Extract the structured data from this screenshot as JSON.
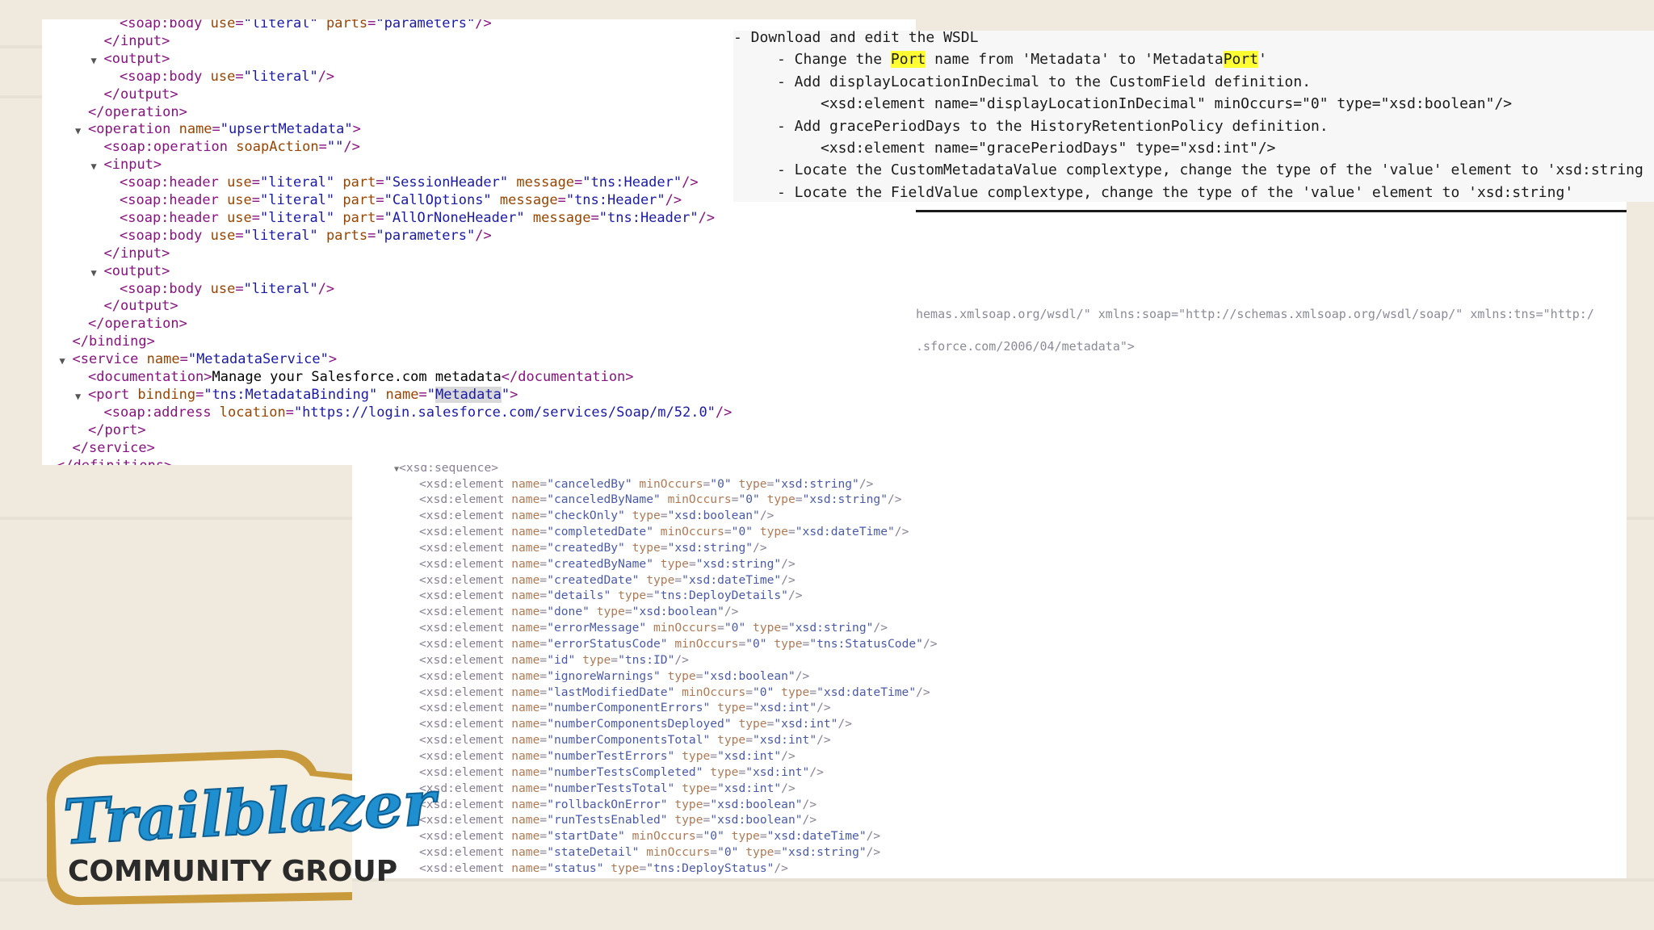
{
  "xml_panel": {
    "lines": [
      {
        "indent": 3,
        "tri": false,
        "html": "&lt;soap:body <span class='an'>use</span>=<span class='av'>\"literal\"</span> <span class='an'>parts</span>=<span class='av'>\"parameters\"</span>/&gt;"
      },
      {
        "indent": 2,
        "tri": false,
        "html": "&lt;/input&gt;"
      },
      {
        "indent": 2,
        "tri": true,
        "html": "&lt;output&gt;"
      },
      {
        "indent": 3,
        "tri": false,
        "html": "&lt;soap:body <span class='an'>use</span>=<span class='av'>\"literal\"</span>/&gt;"
      },
      {
        "indent": 2,
        "tri": false,
        "html": "&lt;/output&gt;"
      },
      {
        "indent": 1,
        "tri": false,
        "html": "&lt;/operation&gt;"
      },
      {
        "indent": 1,
        "tri": true,
        "html": "&lt;operation <span class='an'>name</span>=<span class='av'>\"upsertMetadata\"</span>&gt;"
      },
      {
        "indent": 2,
        "tri": false,
        "html": "&lt;soap:operation <span class='an'>soapAction</span>=<span class='av'>\"\"</span>/&gt;"
      },
      {
        "indent": 2,
        "tri": true,
        "html": "&lt;input&gt;"
      },
      {
        "indent": 3,
        "tri": false,
        "html": "&lt;soap:header <span class='an'>use</span>=<span class='av'>\"literal\"</span> <span class='an'>part</span>=<span class='av'>\"SessionHeader\"</span> <span class='an'>message</span>=<span class='av'>\"tns:Header\"</span>/&gt;"
      },
      {
        "indent": 3,
        "tri": false,
        "html": "&lt;soap:header <span class='an'>use</span>=<span class='av'>\"literal\"</span> <span class='an'>part</span>=<span class='av'>\"CallOptions\"</span> <span class='an'>message</span>=<span class='av'>\"tns:Header\"</span>/&gt;"
      },
      {
        "indent": 3,
        "tri": false,
        "html": "&lt;soap:header <span class='an'>use</span>=<span class='av'>\"literal\"</span> <span class='an'>part</span>=<span class='av'>\"AllOrNoneHeader\"</span> <span class='an'>message</span>=<span class='av'>\"tns:Header\"</span>/&gt;"
      },
      {
        "indent": 3,
        "tri": false,
        "html": "&lt;soap:body <span class='an'>use</span>=<span class='av'>\"literal\"</span> <span class='an'>parts</span>=<span class='av'>\"parameters\"</span>/&gt;"
      },
      {
        "indent": 2,
        "tri": false,
        "html": "&lt;/input&gt;"
      },
      {
        "indent": 2,
        "tri": true,
        "html": "&lt;output&gt;"
      },
      {
        "indent": 3,
        "tri": false,
        "html": "&lt;soap:body <span class='an'>use</span>=<span class='av'>\"literal\"</span>/&gt;"
      },
      {
        "indent": 2,
        "tri": false,
        "html": "&lt;/output&gt;"
      },
      {
        "indent": 1,
        "tri": false,
        "html": "&lt;/operation&gt;"
      },
      {
        "indent": 0,
        "tri": false,
        "html": "&lt;/binding&gt;"
      },
      {
        "indent": 0,
        "tri": true,
        "html": "&lt;service <span class='an'>name</span>=<span class='av'>\"MetadataService\"</span>&gt;"
      },
      {
        "indent": 1,
        "tri": false,
        "html": "&lt;documentation&gt;<span class='tx'>Manage your Salesforce.com metadata</span>&lt;/documentation&gt;"
      },
      {
        "indent": 1,
        "tri": true,
        "html": "&lt;port <span class='an'>binding</span>=<span class='av'>\"tns:MetadataBinding\"</span> <span class='an'>name</span>=<span class='av'>\"<span class='hl'>Metadata</span>\"</span>&gt;"
      },
      {
        "indent": 2,
        "tri": false,
        "html": "&lt;soap:address <span class='an'>location</span>=<span class='av'>\"https://login.salesforce.com/services/Soap/m/52.0\"</span>/&gt;"
      },
      {
        "indent": 1,
        "tri": false,
        "html": "&lt;/port&gt;"
      },
      {
        "indent": 0,
        "tri": false,
        "html": "&lt;/service&gt;"
      },
      {
        "indent": -1,
        "tri": false,
        "html": "&lt;/definitions&gt;"
      }
    ]
  },
  "notes_panel": {
    "lines": [
      {
        "indent": 0,
        "html": "- Download and edit the WSDL"
      },
      {
        "indent": 1,
        "html": "- Change the <span class='yel'>Port</span> name from 'Metadata' to 'Metadata<span class='yel'>Port</span>'"
      },
      {
        "indent": 1,
        "html": "- Add displayLocationInDecimal to the CustomField definition."
      },
      {
        "indent": 2,
        "html": "&lt;xsd:element name=\"displayLocationInDecimal\" minOccurs=\"0\" type=\"xsd:boolean\"/&gt;"
      },
      {
        "indent": 1,
        "html": "- Add gracePeriodDays to the HistoryRetentionPolicy definition."
      },
      {
        "indent": 2,
        "html": "&lt;xsd:element name=\"gracePeriodDays\" type=\"xsd:int\"/&gt;"
      },
      {
        "indent": 1,
        "html": "- Locate the CustomMetadataValue complextype, change the type of the 'value' element to 'xsd:string"
      },
      {
        "indent": 1,
        "html": "- Locate the FieldValue complextype, change the type of the 'value' element to 'xsd:string'"
      }
    ]
  },
  "schema_panel": {
    "line1": "hemas.xmlsoap.org/wsdl/\" xmlns:soap=\"http://schemas.xmlsoap.org/wsdl/soap/\" xmlns:tns=\"http:/",
    "line2": ".sforce.com/2006/04/metadata\">"
  },
  "seq_panel": {
    "header": "<xsd:sequence>",
    "elements": [
      {
        "name": "canceledBy",
        "min": "0",
        "type": "xsd:string"
      },
      {
        "name": "canceledByName",
        "min": "0",
        "type": "xsd:string"
      },
      {
        "name": "checkOnly",
        "min": "",
        "type": "xsd:boolean"
      },
      {
        "name": "completedDate",
        "min": "0",
        "type": "xsd:dateTime"
      },
      {
        "name": "createdBy",
        "min": "",
        "type": "xsd:string"
      },
      {
        "name": "createdByName",
        "min": "",
        "type": "xsd:string"
      },
      {
        "name": "createdDate",
        "min": "",
        "type": "xsd:dateTime"
      },
      {
        "name": "details",
        "min": "",
        "type": "tns:DeployDetails"
      },
      {
        "name": "done",
        "min": "",
        "type": "xsd:boolean"
      },
      {
        "name": "errorMessage",
        "min": "0",
        "type": "xsd:string"
      },
      {
        "name": "errorStatusCode",
        "min": "0",
        "type": "tns:StatusCode"
      },
      {
        "name": "id",
        "min": "",
        "type": "tns:ID"
      },
      {
        "name": "ignoreWarnings",
        "min": "",
        "type": "xsd:boolean"
      },
      {
        "name": "lastModifiedDate",
        "min": "0",
        "type": "xsd:dateTime"
      },
      {
        "name": "numberComponentErrors",
        "min": "",
        "type": "xsd:int"
      },
      {
        "name": "numberComponentsDeployed",
        "min": "",
        "type": "xsd:int"
      },
      {
        "name": "numberComponentsTotal",
        "min": "",
        "type": "xsd:int"
      },
      {
        "name": "numberTestErrors",
        "min": "",
        "type": "xsd:int"
      },
      {
        "name": "numberTestsCompleted",
        "min": "",
        "type": "xsd:int"
      },
      {
        "name": "numberTestsTotal",
        "min": "",
        "type": "xsd:int"
      },
      {
        "name": "rollbackOnError",
        "min": "",
        "type": "xsd:boolean"
      },
      {
        "name": "runTestsEnabled",
        "min": "",
        "type": "xsd:boolean"
      },
      {
        "name": "startDate",
        "min": "0",
        "type": "xsd:dateTime"
      },
      {
        "name": "stateDetail",
        "min": "0",
        "type": "xsd:string"
      },
      {
        "name": "status",
        "min": "",
        "type": "tns:DeployStatus"
      }
    ]
  },
  "logo": {
    "title": "Trailblazer",
    "subtitle": "COMMUNITY GROUP",
    "colors": {
      "blue": "#1f8fd0",
      "gold": "#c99a3c",
      "cream": "#f6efdf",
      "dark": "#2b2b2b"
    }
  }
}
